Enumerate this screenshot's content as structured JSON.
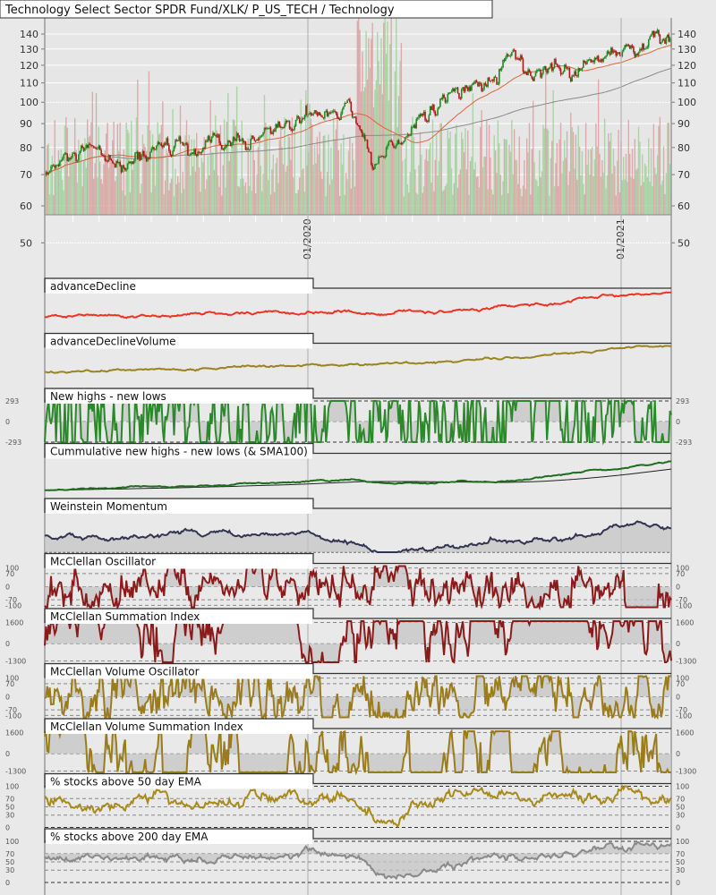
{
  "header": {
    "title": "Technology Select Sector SPDR Fund/XLK/ P_US_TECH / Technology"
  },
  "chart_data": [
    {
      "type": "candlestick",
      "name": "price",
      "title": "Technology Select Sector SPDR Fund/XLK/ P_US_TECH / Technology",
      "yscale": "log",
      "yticks": [
        50,
        60,
        70,
        80,
        90,
        100,
        110,
        120,
        130,
        140
      ],
      "ylim": [
        50,
        150
      ],
      "x_tick_labels": [
        "01/2020",
        "01/2021"
      ],
      "x_range_years": [
        2019.16,
        2021.16
      ],
      "price_keyframes": [
        [
          2019.16,
          70
        ],
        [
          2019.25,
          76
        ],
        [
          2019.33,
          78
        ],
        [
          2019.4,
          72
        ],
        [
          2019.47,
          77
        ],
        [
          2019.55,
          81
        ],
        [
          2019.62,
          77
        ],
        [
          2019.7,
          80
        ],
        [
          2019.8,
          82
        ],
        [
          2019.88,
          87
        ],
        [
          2019.97,
          92
        ],
        [
          2020.05,
          95
        ],
        [
          2020.12,
          99
        ],
        [
          2020.17,
          88
        ],
        [
          2020.21,
          71
        ],
        [
          2020.25,
          80
        ],
        [
          2020.33,
          88
        ],
        [
          2020.42,
          98
        ],
        [
          2020.5,
          106
        ],
        [
          2020.58,
          112
        ],
        [
          2020.66,
          126
        ],
        [
          2020.72,
          112
        ],
        [
          2020.8,
          118
        ],
        [
          2020.86,
          114
        ],
        [
          2020.92,
          126
        ],
        [
          2021.0,
          130
        ],
        [
          2021.06,
          131
        ],
        [
          2021.13,
          138
        ],
        [
          2021.16,
          131
        ]
      ],
      "moving_averages": [
        {
          "name": "SMA50",
          "color": "#e0643c"
        },
        {
          "name": "SMA200",
          "color": "#8a8a8a"
        }
      ],
      "colors": {
        "up": "#1e8c1e",
        "down": "#b01818",
        "vol_up": "#9fd09a",
        "vol_down": "#d8a0a0"
      }
    },
    {
      "type": "line",
      "title": "advanceDecline",
      "color": "#ee3322",
      "ylim": [
        -40,
        100
      ],
      "yticks": [],
      "keyframes": [
        [
          2019.16,
          10
        ],
        [
          2019.6,
          18
        ],
        [
          2020.0,
          30
        ],
        [
          2020.15,
          32
        ],
        [
          2020.22,
          22
        ],
        [
          2020.35,
          30
        ],
        [
          2020.6,
          45
        ],
        [
          2020.9,
          75
        ],
        [
          2021.16,
          100
        ]
      ]
    },
    {
      "type": "line",
      "title": "advanceDeclineVolume",
      "color": "#9a8420",
      "ylim": [
        -60,
        100
      ],
      "yticks": [],
      "keyframes": [
        [
          2019.16,
          0
        ],
        [
          2019.6,
          10
        ],
        [
          2020.0,
          25
        ],
        [
          2020.2,
          30
        ],
        [
          2020.4,
          40
        ],
        [
          2020.7,
          60
        ],
        [
          2021.0,
          90
        ],
        [
          2021.16,
          98
        ]
      ]
    },
    {
      "type": "line",
      "title": "New highs - new lows",
      "color": "#2a8a2a",
      "ylim": [
        -293,
        293
      ],
      "yticks": [
        293,
        0,
        -293
      ],
      "zero": 0,
      "keyframes": [
        [
          2019.16,
          10
        ],
        [
          2019.9,
          15
        ],
        [
          2020.0,
          30
        ],
        [
          2020.15,
          20
        ],
        [
          2020.19,
          -120
        ],
        [
          2020.23,
          -150
        ],
        [
          2020.27,
          -30
        ],
        [
          2020.4,
          10
        ],
        [
          2021.16,
          25
        ]
      ]
    },
    {
      "type": "line",
      "title": "Cummulative new highs - new lows (& SMA100)",
      "color": "#1e6e1e",
      "sma_color": "#222222",
      "ylim": [
        -20,
        100
      ],
      "yticks": [],
      "keyframes": [
        [
          2019.16,
          0
        ],
        [
          2019.6,
          15
        ],
        [
          2020.0,
          25
        ],
        [
          2020.15,
          28
        ],
        [
          2020.25,
          20
        ],
        [
          2020.6,
          25
        ],
        [
          2020.9,
          55
        ],
        [
          2021.16,
          90
        ]
      ]
    },
    {
      "type": "area",
      "title": "Weinstein Momentum",
      "color": "#333352",
      "ylim": [
        0,
        100
      ],
      "yticks": [],
      "zero": 0,
      "keyframes": [
        [
          2019.16,
          40
        ],
        [
          2019.4,
          35
        ],
        [
          2019.7,
          50
        ],
        [
          2019.9,
          45
        ],
        [
          2020.0,
          40
        ],
        [
          2020.2,
          15
        ],
        [
          2020.25,
          2
        ],
        [
          2020.45,
          10
        ],
        [
          2020.6,
          30
        ],
        [
          2020.75,
          35
        ],
        [
          2020.9,
          45
        ],
        [
          2021.0,
          75
        ],
        [
          2021.16,
          65
        ]
      ]
    },
    {
      "type": "area",
      "title": "McClellan Oscillator",
      "color": "#8b1a1a",
      "ylim": [
        -110,
        110
      ],
      "yticks": [
        100,
        70,
        0,
        -70,
        -100
      ],
      "zero": 0,
      "keyframes": [
        [
          2019.16,
          -10
        ],
        [
          2019.3,
          -40
        ],
        [
          2019.5,
          0
        ],
        [
          2020.0,
          10
        ],
        [
          2020.17,
          -60
        ],
        [
          2020.22,
          -100
        ],
        [
          2020.27,
          60
        ],
        [
          2020.35,
          20
        ],
        [
          2021.16,
          -30
        ]
      ]
    },
    {
      "type": "area",
      "title": "McClellan Summation Index",
      "color": "#8b1a1a",
      "ylim": [
        -1400,
        1700
      ],
      "yticks": [
        1600,
        0,
        -1300
      ],
      "zero": 0,
      "keyframes": [
        [
          2019.16,
          1100
        ],
        [
          2019.35,
          500
        ],
        [
          2019.55,
          600
        ],
        [
          2019.8,
          300
        ],
        [
          2020.0,
          150
        ],
        [
          2020.12,
          -300
        ],
        [
          2020.25,
          -1350
        ],
        [
          2020.4,
          -500
        ],
        [
          2020.55,
          400
        ],
        [
          2020.7,
          100
        ],
        [
          2020.85,
          -150
        ],
        [
          2021.0,
          450
        ],
        [
          2021.1,
          450
        ],
        [
          2021.16,
          250
        ]
      ]
    },
    {
      "type": "area",
      "title": "McClellan Volume Oscillator",
      "color": "#9a7c1a",
      "ylim": [
        -110,
        110
      ],
      "yticks": [
        100,
        70,
        0,
        -70,
        -100
      ],
      "zero": 0,
      "keyframes": [
        [
          2019.16,
          -10
        ],
        [
          2019.5,
          10
        ],
        [
          2020.0,
          10
        ],
        [
          2020.17,
          -60
        ],
        [
          2020.22,
          -100
        ],
        [
          2020.27,
          70
        ],
        [
          2020.4,
          30
        ],
        [
          2021.16,
          -20
        ]
      ]
    },
    {
      "type": "area",
      "title": "McClellan Volume Summation Index",
      "color": "#9a7c1a",
      "ylim": [
        -1400,
        1700
      ],
      "yticks": [
        1600,
        0,
        -1300
      ],
      "zero": 0,
      "keyframes": [
        [
          2019.16,
          1000
        ],
        [
          2019.35,
          300
        ],
        [
          2019.6,
          600
        ],
        [
          2019.85,
          400
        ],
        [
          2020.0,
          600
        ],
        [
          2020.12,
          100
        ],
        [
          2020.25,
          -1350
        ],
        [
          2020.4,
          -300
        ],
        [
          2020.55,
          800
        ],
        [
          2020.7,
          900
        ],
        [
          2020.85,
          100
        ],
        [
          2021.0,
          1000
        ],
        [
          2021.1,
          1000
        ],
        [
          2021.16,
          700
        ]
      ]
    },
    {
      "type": "line",
      "title": "% stocks above 50 day EMA",
      "color": "#a88a1a",
      "ylim": [
        0,
        100
      ],
      "yticks": [
        100,
        70,
        50,
        30,
        0
      ],
      "keyframes": [
        [
          2019.16,
          75
        ],
        [
          2019.35,
          55
        ],
        [
          2019.55,
          75
        ],
        [
          2019.75,
          60
        ],
        [
          2019.95,
          80
        ],
        [
          2020.1,
          70
        ],
        [
          2020.2,
          30
        ],
        [
          2020.25,
          8
        ],
        [
          2020.32,
          30
        ],
        [
          2020.45,
          80
        ],
        [
          2020.7,
          75
        ],
        [
          2020.85,
          60
        ],
        [
          2021.0,
          88
        ],
        [
          2021.16,
          70
        ]
      ]
    },
    {
      "type": "area",
      "title": "% stocks above 200 day EMA",
      "color": "#8a8a8a",
      "ylim": [
        0,
        100
      ],
      "yticks": [
        100,
        70,
        50,
        30,
        0
      ],
      "zero": 70,
      "keyframes": [
        [
          2019.16,
          65
        ],
        [
          2019.4,
          60
        ],
        [
          2019.6,
          62
        ],
        [
          2019.8,
          55
        ],
        [
          2020.0,
          70
        ],
        [
          2020.15,
          60
        ],
        [
          2020.25,
          5
        ],
        [
          2020.4,
          30
        ],
        [
          2020.55,
          60
        ],
        [
          2020.8,
          65
        ],
        [
          2020.95,
          90
        ],
        [
          2021.16,
          92
        ]
      ]
    }
  ]
}
